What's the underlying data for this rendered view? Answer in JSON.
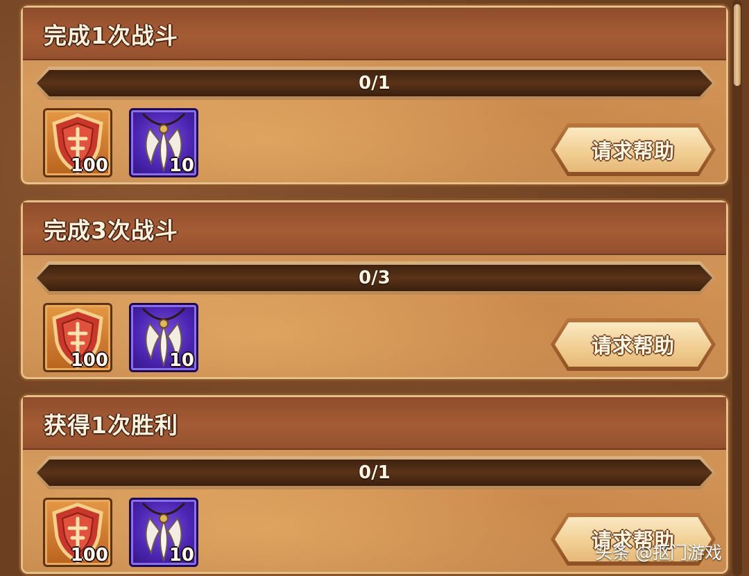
{
  "tasks": [
    {
      "title": "完成1次战斗",
      "progress": {
        "current": 0,
        "target": 1,
        "text": "0/1"
      },
      "rewards": [
        {
          "icon": "shield-icon",
          "count": "100"
        },
        {
          "icon": "claw-necklace-icon",
          "count": "10"
        }
      ],
      "button_label": "请求帮助"
    },
    {
      "title": "完成3次战斗",
      "progress": {
        "current": 0,
        "target": 3,
        "text": "0/3"
      },
      "rewards": [
        {
          "icon": "shield-icon",
          "count": "100"
        },
        {
          "icon": "claw-necklace-icon",
          "count": "10"
        }
      ],
      "button_label": "请求帮助"
    },
    {
      "title": "获得1次胜利",
      "progress": {
        "current": 0,
        "target": 1,
        "text": "0/1"
      },
      "rewards": [
        {
          "icon": "shield-icon",
          "count": "100"
        },
        {
          "icon": "claw-necklace-icon",
          "count": "10"
        }
      ],
      "button_label": "请求帮助"
    }
  ],
  "watermark": "头条 @抠门游戏",
  "colors": {
    "header": "#a55c35",
    "card": "#d79b5c",
    "progress_track": "#4a2a14",
    "shield_frame": "#e59a44",
    "claw_frame": "#4a24b0"
  }
}
